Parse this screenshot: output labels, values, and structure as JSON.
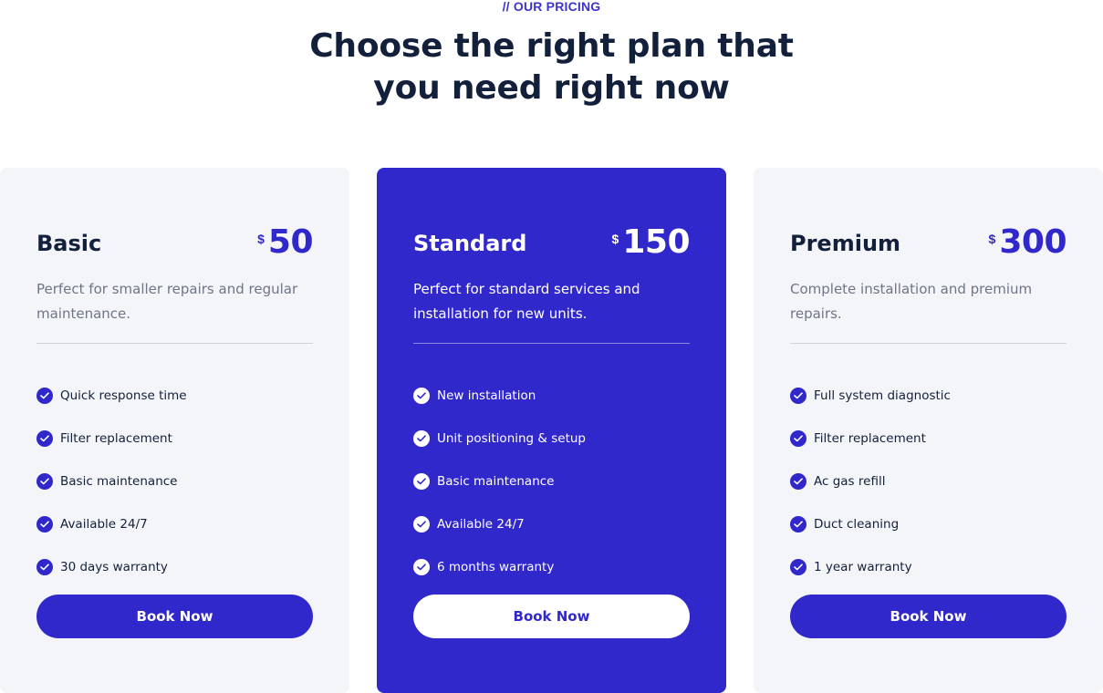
{
  "section": {
    "eyebrow": "// OUR PRICING",
    "headline_line1": "Choose the right plan that",
    "headline_line2": "you need right now"
  },
  "colors": {
    "accent": "#3128cb",
    "heading": "#13203b",
    "card_bg": "#f4f5f9",
    "muted_text": "#6d7586"
  },
  "plans": [
    {
      "name": "Basic",
      "currency": "$",
      "price": "50",
      "description": "Perfect for smaller repairs and regular maintenance.",
      "features": [
        "Quick response time",
        "Filter replacement",
        "Basic maintenance",
        "Available 24/7",
        "30 days warranty"
      ],
      "cta": "Book Now",
      "feature_icon": "check-circle-icon"
    },
    {
      "name": "Standard",
      "currency": "$",
      "price": "150",
      "description": "Perfect for standard services and installation for new units.",
      "features": [
        "New installation",
        "Unit positioning & setup",
        "Basic maintenance",
        "Available 24/7",
        "6 months warranty"
      ],
      "cta": "Book Now",
      "feature_icon": "check-circle-icon",
      "featured": true
    },
    {
      "name": "Premium",
      "currency": "$",
      "price": "300",
      "description": "Complete installation and premium repairs.",
      "features": [
        "Full system diagnostic",
        "Filter replacement",
        "Ac gas refill",
        "Duct cleaning",
        "1 year warranty"
      ],
      "cta": "Book Now",
      "feature_icon": "check-circle-icon"
    }
  ]
}
